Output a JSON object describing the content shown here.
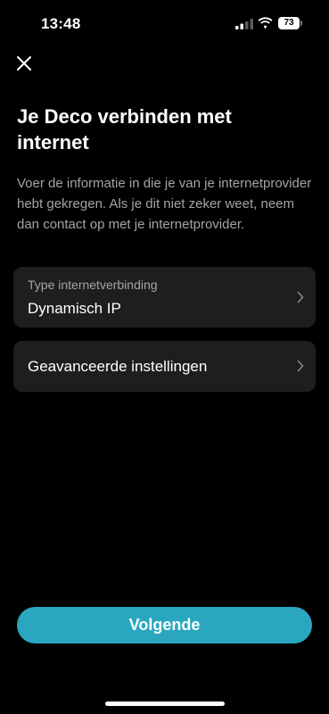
{
  "status_bar": {
    "time": "13:48",
    "battery_level": "73",
    "icons": [
      "signal-icon",
      "wifi-icon",
      "battery-icon"
    ]
  },
  "header": {
    "close_icon": "close-icon"
  },
  "main": {
    "title": "Je Deco verbinden met internet",
    "description": "Voer de informatie in die je van je internetprovider hebt gekregen. Als je dit niet zeker weet, neem dan contact op met je internetprovider."
  },
  "connection_type": {
    "label": "Type internetverbinding",
    "value": "Dynamisch IP",
    "icon": "chevron-right-icon"
  },
  "advanced_settings": {
    "label": "Geavanceerde instellingen",
    "icon": "chevron-right-icon"
  },
  "footer": {
    "next_label": "Volgende"
  },
  "colors": {
    "background": "#000000",
    "card": "#1e1e20",
    "secondary_text": "#a4a4a8",
    "accent": "#2aa7be"
  }
}
